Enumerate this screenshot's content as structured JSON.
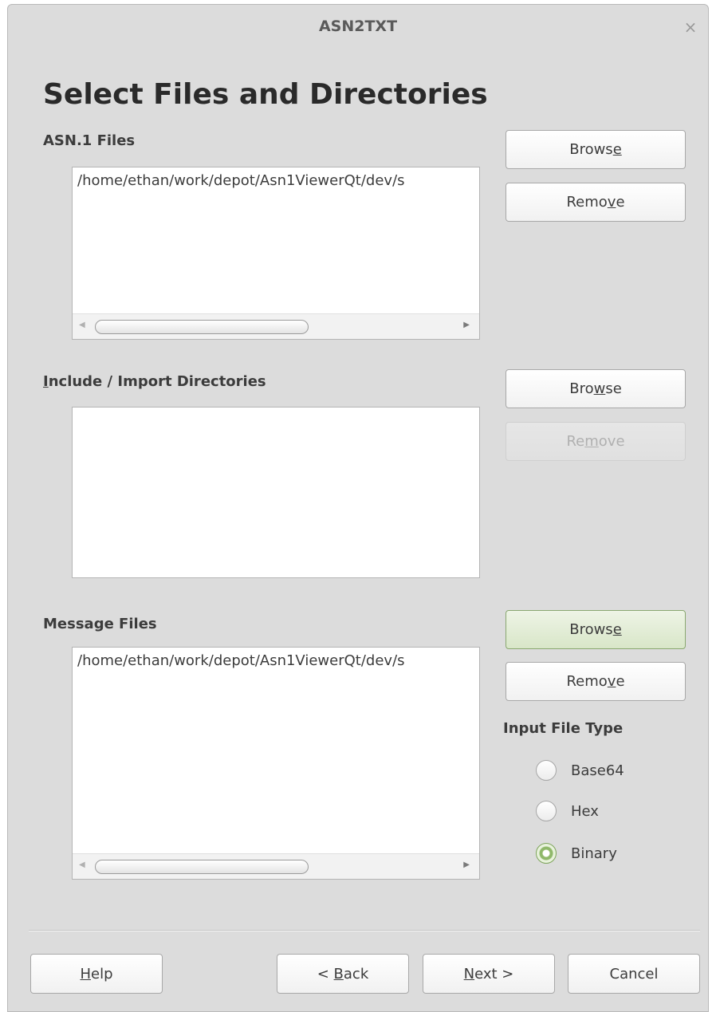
{
  "window": {
    "title": "ASN2TXT",
    "close_glyph": "×"
  },
  "page": {
    "title": "Select Files and Directories"
  },
  "asn_files": {
    "label": "ASN.1 Files",
    "items": [
      "/home/ethan/work/depot/Asn1ViewerQt/dev/s"
    ],
    "browse": {
      "pre": "Brows",
      "mnemonic": "e",
      "post": ""
    },
    "remove": {
      "pre": "Remo",
      "mnemonic": "v",
      "post": "e"
    }
  },
  "include_dirs": {
    "label": {
      "pre": "",
      "mnemonic": "I",
      "post": "nclude / Import Directories"
    },
    "items": [],
    "browse": {
      "pre": "Bro",
      "mnemonic": "w",
      "post": "se"
    },
    "remove": {
      "pre": "Re",
      "mnemonic": "m",
      "post": "ove"
    }
  },
  "message_files": {
    "label": "Message Files",
    "items": [
      "/home/ethan/work/depot/Asn1ViewerQt/dev/s"
    ],
    "browse": {
      "pre": "Brows",
      "mnemonic": "e",
      "post": ""
    },
    "remove": {
      "pre": "Remo",
      "mnemonic": "v",
      "post": "e"
    }
  },
  "input_file_type": {
    "label": "Input File Type",
    "options": [
      "Base64",
      "Hex",
      "Binary"
    ],
    "selected": "Binary"
  },
  "footer": {
    "help": {
      "pre": "",
      "mnemonic": "H",
      "post": "elp"
    },
    "back": {
      "pre": "< ",
      "mnemonic": "B",
      "post": "ack"
    },
    "next": {
      "pre": "",
      "mnemonic": "N",
      "post": "ext >"
    },
    "cancel": "Cancel"
  },
  "colors": {
    "window_bg": "#dcdcdc",
    "list_bg": "#ffffff",
    "focus_green": "#8aa870",
    "radio_checked": "#8fb86a"
  }
}
